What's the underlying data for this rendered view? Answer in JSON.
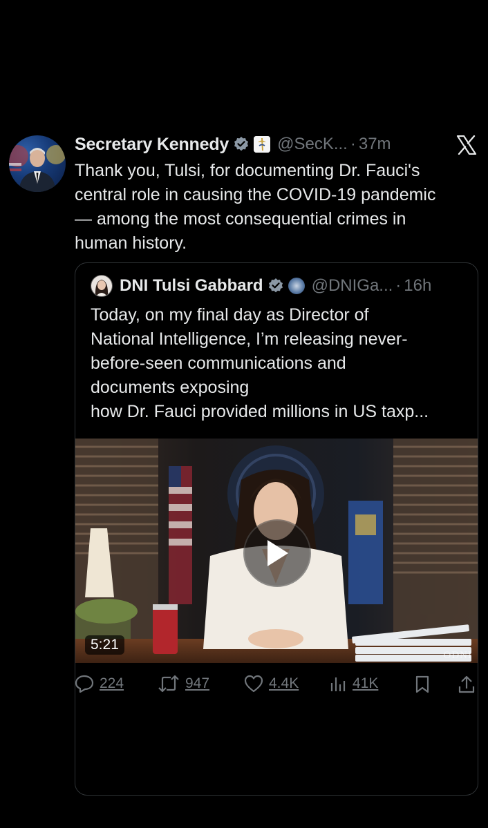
{
  "post": {
    "author_name": "Secretary Kennedy",
    "handle": "@SecK...",
    "separator": "·",
    "time": "37m",
    "text": "Thank you, Tulsi, for documenting Dr. Fauci's\ncentral role in causing the COVID-19 pandemic\n— among the most consequential crimes in\nhuman history."
  },
  "quoted_post": {
    "author_name": "DNI Tulsi Gabbard",
    "handle": "@DNIGa...",
    "separator": "·",
    "time": "16h",
    "text": "Today, on my final day as Director of\nNational Intelligence, I’m releasing never-\nbefore-seen communications and\ndocuments exposing\nhow Dr. Fauci provided millions in US taxp...",
    "video": {
      "duration": "5:21",
      "watermark": "ODNI"
    }
  },
  "actions": {
    "replies": "224",
    "reposts": "947",
    "likes": "4.4K",
    "views": "41K"
  },
  "icons": {
    "verified": "verified-badge-icon",
    "x_logo": "x-logo-icon",
    "reply": "reply-icon",
    "repost": "repost-icon",
    "like": "heart-icon",
    "views": "views-icon",
    "bookmark": "bookmark-icon",
    "share": "share-icon"
  },
  "colors": {
    "background": "#000000",
    "text": "#e7e9ea",
    "muted": "#71767b",
    "border": "#2f3336"
  }
}
